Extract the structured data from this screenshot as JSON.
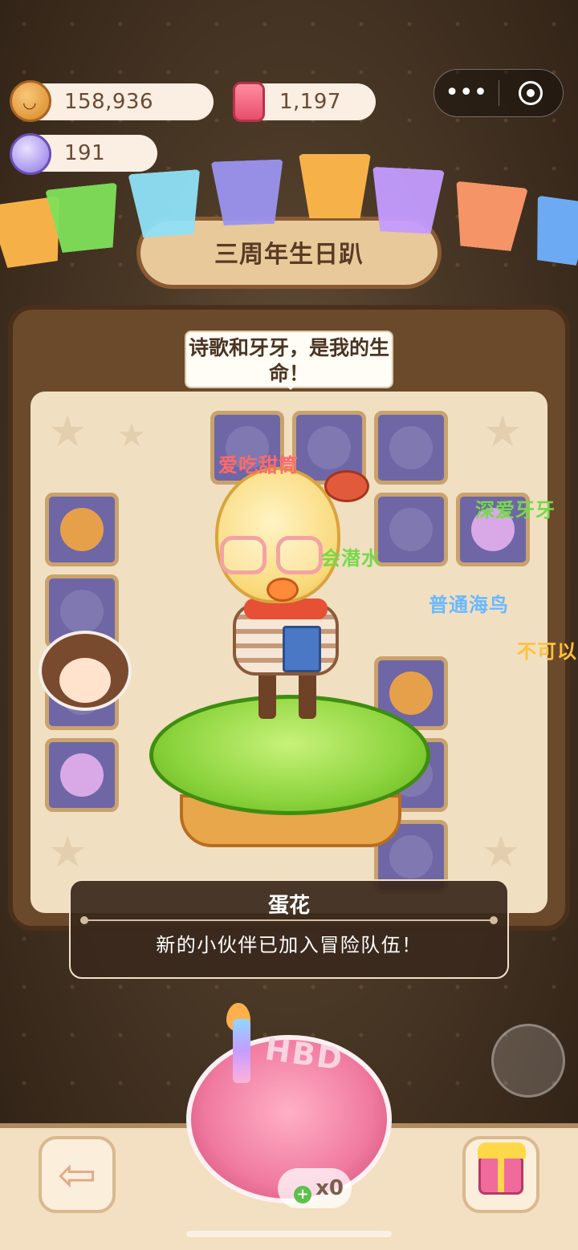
{
  "currencies": {
    "coins": {
      "icon": "cookie-coin-icon",
      "value": "158,936"
    },
    "gems": {
      "icon": "jelly-gem-icon",
      "value": "1,197"
    },
    "candy": {
      "icon": "candy-icon",
      "value": "191"
    }
  },
  "capsule": {
    "more_icon": "more-dots-icon",
    "close_icon": "target-close-icon"
  },
  "banner": {
    "title": "三周年生日趴"
  },
  "character": {
    "speech": "诗歌和牙牙，是我的生命！"
  },
  "tags": [
    {
      "text": "爱吃甜筒",
      "color": "#ff6a6a"
    },
    {
      "text": "会潜水",
      "color": "#76d94a"
    },
    {
      "text": "深爱牙牙",
      "color": "#76d94a"
    },
    {
      "text": "普通海鸟",
      "color": "#6ab8ff"
    },
    {
      "text": "不可以",
      "color": "#ffc23a"
    }
  ],
  "notice": {
    "name": "蛋花",
    "message": "新的小伙伴已加入冒险队伍！"
  },
  "bottom": {
    "back_icon": "back-arrow-icon",
    "gift_icon": "gift-box-icon",
    "cake_text": "HBD",
    "count": "x0"
  }
}
